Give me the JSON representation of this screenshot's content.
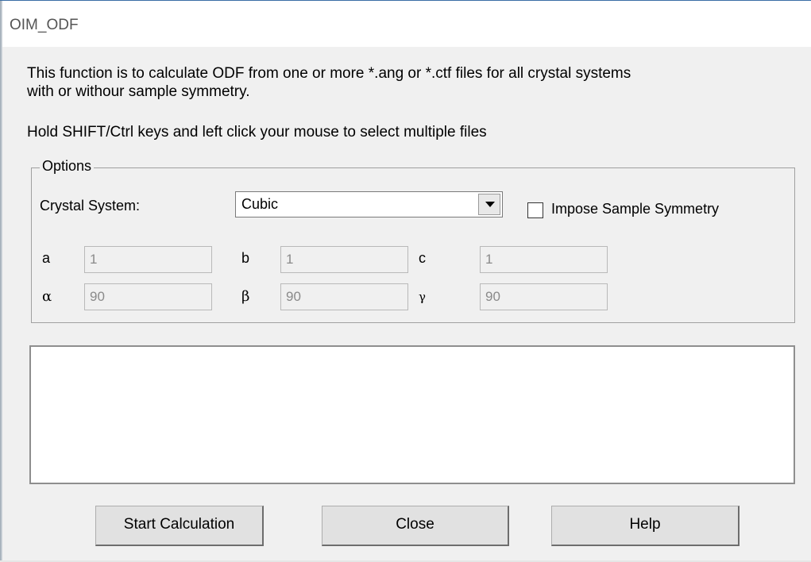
{
  "window": {
    "title": "OIM_ODF"
  },
  "description": {
    "line1": "This function is to calculate ODF from one or more *.ang or *.ctf files for all crystal systems",
    "line2": "with or withour sample symmetry.",
    "line3": "Hold SHIFT/Ctrl keys and left click your mouse to select multiple files"
  },
  "options": {
    "legend": "Options",
    "crystal_system_label": "Crystal System:",
    "crystal_system_value": "Cubic",
    "impose_symmetry_label": "Impose Sample Symmetry",
    "impose_symmetry_checked": false,
    "params": {
      "a": {
        "label": "a",
        "value": "1"
      },
      "b": {
        "label": "b",
        "value": "1"
      },
      "c": {
        "label": "c",
        "value": "1"
      },
      "alpha": {
        "label": "α",
        "value": "90"
      },
      "beta": {
        "label": "β",
        "value": "90"
      },
      "gamma": {
        "label": "γ",
        "value": "90"
      }
    }
  },
  "buttons": {
    "start": "Start  Calculation",
    "close": "Close",
    "help": "Help"
  },
  "icons": {
    "dropdown": "chevron-down-icon"
  }
}
